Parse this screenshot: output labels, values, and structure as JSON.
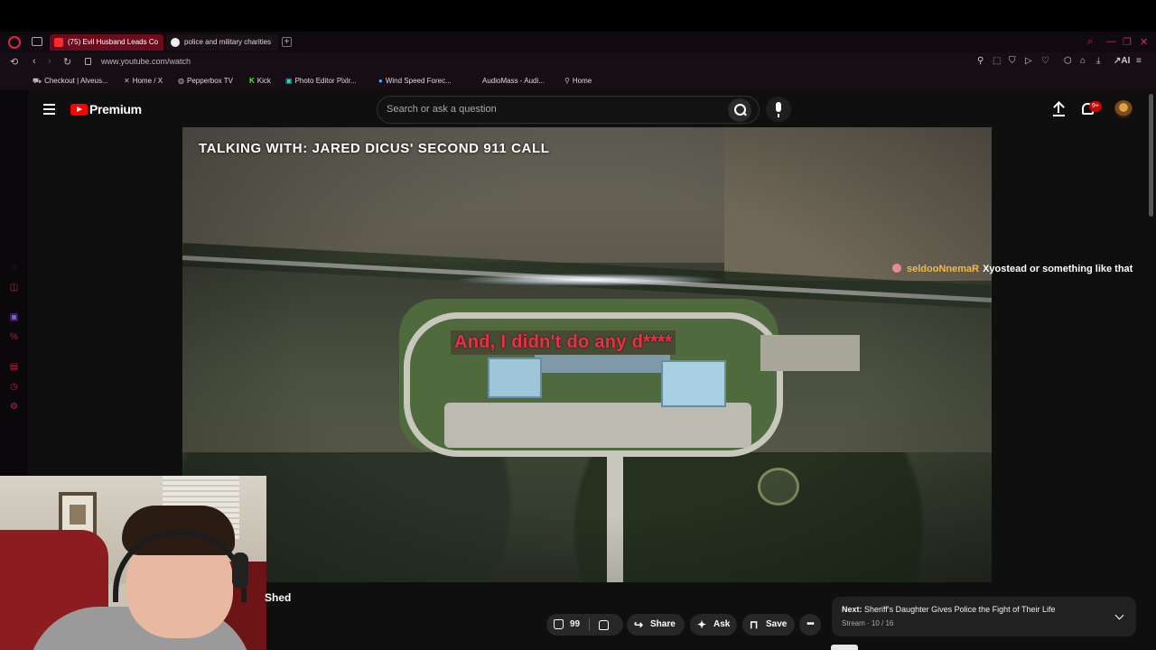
{
  "browser": {
    "tabs": [
      {
        "label": "(75) Evil Husband Leads Co",
        "active": true
      },
      {
        "label": "police and military charities",
        "active": false
      }
    ],
    "url": "www.youtube.com/watch",
    "bookmarks": [
      {
        "label": "Checkout | Alveus...",
        "icon": "cart-icon"
      },
      {
        "label": "Home / X",
        "icon": "x-icon"
      },
      {
        "label": "Pepperbox TV",
        "icon": "pepperbox-icon"
      },
      {
        "label": "Kick",
        "icon": "kick-icon"
      },
      {
        "label": "Photo Editor Pixlr...",
        "icon": "pixlr-icon"
      },
      {
        "label": "Wind Speed Forec...",
        "icon": "globe-icon"
      },
      {
        "label": "AudioMass - Audi...",
        "icon": "audio-icon"
      },
      {
        "label": "Home",
        "icon": "pin-icon"
      }
    ],
    "toolbar_ai": "AI",
    "accent": "#e0264a"
  },
  "youtube": {
    "brand": "Premium",
    "search_placeholder": "Search or ask a question",
    "notifications_badge": "9+"
  },
  "video": {
    "overlay_title": "TALKING WITH: JARED DICUS' SECOND 911 CALL",
    "caption": "And, I didn't do any d****",
    "chat": {
      "user": "seldooNnemaR",
      "message": "Xyostead or something like that"
    },
    "title_fragment": "Shed"
  },
  "actions": {
    "likes": "99",
    "share": "Share",
    "ask": "Ask",
    "save": "Save",
    "more": "•••"
  },
  "next": {
    "prefix": "Next:",
    "title": "Sheriff's Daughter Gives Police the Fight of Their Life",
    "sub": "Stream · 10 / 16"
  }
}
